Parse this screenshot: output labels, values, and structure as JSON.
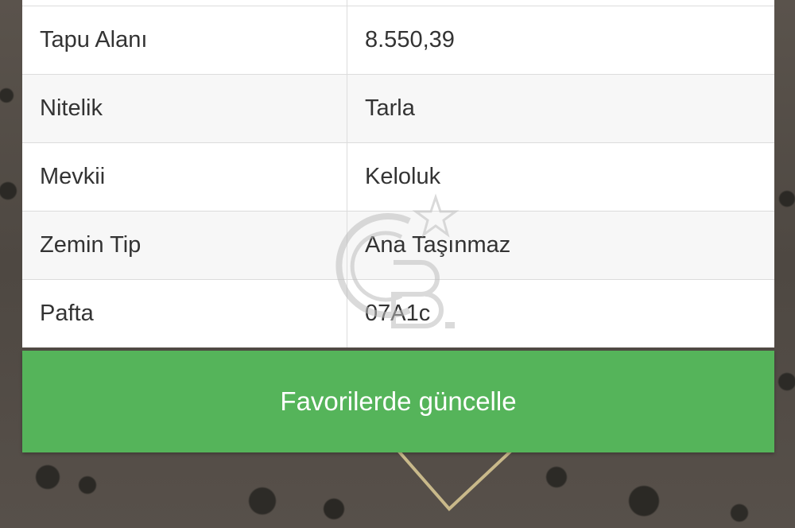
{
  "details": {
    "rows": [
      {
        "key": "Tapu Alanı",
        "value": "8.550,39"
      },
      {
        "key": "Nitelik",
        "value": "Tarla"
      },
      {
        "key": "Mevkii",
        "value": "Keloluk"
      },
      {
        "key": "Zemin Tip",
        "value": "Ana Taşınmaz"
      },
      {
        "key": "Pafta",
        "value": "07A1c"
      }
    ]
  },
  "actions": {
    "update_favorites_label": "Favorilerde güncelle"
  },
  "watermark": {
    "logo_text": "CB"
  },
  "colors": {
    "button_green": "#55b45a",
    "table_border": "#dcdcdc",
    "row_alt": "#f7f7f7"
  }
}
